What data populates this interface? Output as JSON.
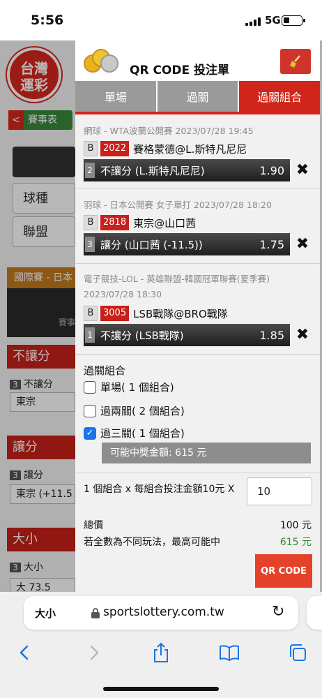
{
  "status": {
    "time": "5:56",
    "network": "5G"
  },
  "background_site": {
    "logo_line1": "台灣",
    "logo_line2": "運彩",
    "schedule_label": "賽事表",
    "filter_sport": "球種",
    "filter_league": "聯盟",
    "intl_label": "國際賽 - 日本",
    "dark_text": "賽事",
    "section1": {
      "title": "不讓分",
      "num": "3",
      "label": "不讓分",
      "value": "東宗"
    },
    "section2": {
      "title": "讓分",
      "num": "3",
      "label": "讓分",
      "value": "東宗 (+11.5"
    },
    "section3": {
      "title": "大小",
      "num": "3",
      "label": "大小",
      "value": "大 73.5"
    }
  },
  "panel": {
    "title": "QR CODE 投注單",
    "tabs": [
      {
        "label": "單場",
        "active": false
      },
      {
        "label": "過關",
        "active": false
      },
      {
        "label": "過關組合",
        "active": true
      }
    ],
    "bets": [
      {
        "league": "網球 - WTA波蘭公開賽 2023/07/28 19:45",
        "type": "B",
        "code": "2022",
        "match": "賽格蒙德@L.斯特凡尼尼",
        "num": "2",
        "pick": "不讓分 (L.斯特凡尼尼)",
        "odds": "1.90"
      },
      {
        "league": "羽球 - 日本公開賽 女子單打 2023/07/28 18:20",
        "type": "B",
        "code": "2818",
        "match": "東宗@山口茜",
        "num": "3",
        "pick": "讓分 (山口茜 (-11.5))",
        "odds": "1.75"
      },
      {
        "league": "電子競技-LOL - 英雄聯盟-韓國冠軍聯賽(夏季賽)",
        "league2": "2023/07/28 18:30",
        "type": "B",
        "code": "3005",
        "match": "LSB戰隊@BRO戰隊",
        "num": "1",
        "pick": "不讓分 (LSB戰隊)",
        "odds": "1.85"
      }
    ],
    "combo": {
      "title": "過關組合",
      "options": [
        {
          "label": "單場( 1 個組合)",
          "checked": false
        },
        {
          "label": "過兩關( 2 個組合)",
          "checked": false
        },
        {
          "label": "過三關( 1 個組合)",
          "checked": true
        }
      ],
      "prize": "可能中獎金額: 615 元"
    },
    "stake": {
      "label": "1 個組合 x 每組合投注金額10元 X",
      "value": "10"
    },
    "total_label": "總價",
    "total_value": "100 元",
    "max_label": "若全數為不同玩法，最高可能中",
    "max_value": "615 元",
    "qr_button": "QR CODE"
  },
  "browser": {
    "text_size": "大小",
    "url": "sportslottery.com.tw"
  }
}
